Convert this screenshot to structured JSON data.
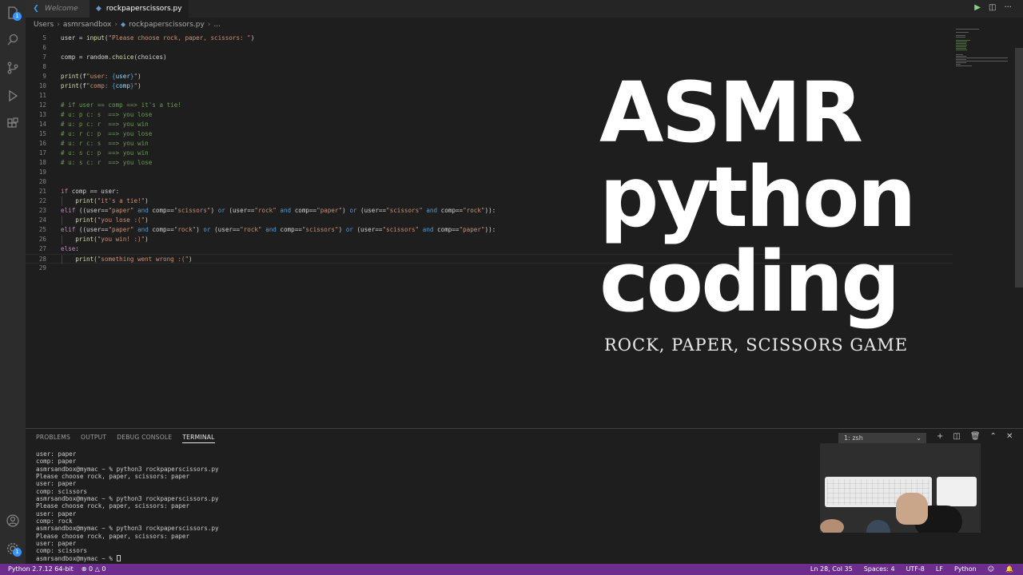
{
  "tabs": [
    {
      "label": "Welcome",
      "icon": "vscode-logo-icon"
    },
    {
      "label": "rockpaperscissors.py",
      "icon": "python-file-icon",
      "dirty": true
    }
  ],
  "breadcrumb": [
    "Users",
    "asmrsandbox",
    "rockpaperscissors.py",
    "..."
  ],
  "code_lines": [
    {
      "num": "5",
      "text": "user = input(\"Please choose rock, paper, scissors: \")"
    },
    {
      "num": "6",
      "text": ""
    },
    {
      "num": "7",
      "text": "comp = random.choice(choices)"
    },
    {
      "num": "8",
      "text": ""
    },
    {
      "num": "9",
      "text": "print(f\"user: {user}\")"
    },
    {
      "num": "10",
      "text": "print(f\"comp: {comp}\")"
    },
    {
      "num": "11",
      "text": ""
    },
    {
      "num": "12",
      "text": "# if user == comp ==> it's a tie!"
    },
    {
      "num": "13",
      "text": "# u: p c: s  ==> you lose"
    },
    {
      "num": "14",
      "text": "# u: p c: r  ==> you win"
    },
    {
      "num": "15",
      "text": "# u: r c: p  ==> you lose"
    },
    {
      "num": "16",
      "text": "# u: r c: s  ==> you win"
    },
    {
      "num": "17",
      "text": "# u: s c: p  ==> you win"
    },
    {
      "num": "18",
      "text": "# u: s c: r  ==> you lose"
    },
    {
      "num": "19",
      "text": ""
    },
    {
      "num": "20",
      "text": ""
    },
    {
      "num": "21",
      "text": "if comp == user:"
    },
    {
      "num": "22",
      "text": "    print(\"it's a tie!\")"
    },
    {
      "num": "23",
      "text": "elif ((user==\"paper\" and comp==\"scissors\") or (user==\"rock\" and comp==\"paper\") or (user==\"scissors\" and comp==\"rock\")):"
    },
    {
      "num": "24",
      "text": "    print(\"you lose :(\")"
    },
    {
      "num": "25",
      "text": "elif ((user==\"paper\" and comp==\"rock\") or (user==\"rock\" and comp==\"scissors\") or (user==\"scissors\" and comp==\"paper\")):"
    },
    {
      "num": "26",
      "text": "    print(\"you win! :)\")"
    },
    {
      "num": "27",
      "text": "else:"
    },
    {
      "num": "28",
      "text": "    print(\"something went wrong :(\")"
    },
    {
      "num": "29",
      "text": ""
    }
  ],
  "overlay": {
    "title_line1": "ASMR",
    "title_line2": "python",
    "title_line3": "coding",
    "subtitle": "ROCK, PAPER, SCISSORS GAME"
  },
  "panel": {
    "tabs": [
      "PROBLEMS",
      "OUTPUT",
      "DEBUG CONSOLE",
      "TERMINAL"
    ],
    "active_tab": "TERMINAL",
    "terminal_select": "1: zsh",
    "terminal_lines": [
      "user: paper",
      "comp: paper",
      "asmrsandbox@mymac ~ % python3 rockpaperscissors.py",
      "Please choose rock, paper, scissors: paper",
      "user: paper",
      "comp: scissors",
      "asmrsandbox@mymac ~ % python3 rockpaperscissors.py",
      "Please choose rock, paper, scissors: paper",
      "user: paper",
      "comp: rock",
      "asmrsandbox@mymac ~ % python3 rockpaperscissors.py",
      "Please choose rock, paper, scissors: paper",
      "user: paper",
      "comp: scissors",
      "asmrsandbox@mymac ~ % "
    ]
  },
  "statusbar": {
    "python": "Python 2.7.12 64-bit",
    "errors": "0",
    "warnings": "0",
    "position": "Ln 28, Col 35",
    "spaces": "Spaces: 4",
    "encoding": "UTF-8",
    "eol": "LF",
    "language": "Python",
    "color": "#6c2d8c"
  },
  "activity_badges": {
    "explorer": "1",
    "settings": "1"
  }
}
